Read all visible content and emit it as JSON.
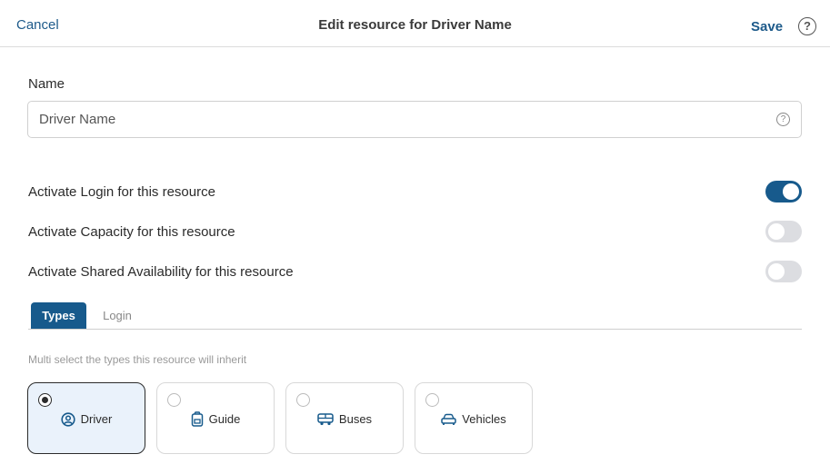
{
  "header": {
    "cancel_label": "Cancel",
    "title": "Edit resource for Driver Name",
    "save_label": "Save",
    "help_glyph": "?"
  },
  "name_field": {
    "label": "Name",
    "value": "Driver Name",
    "help_glyph": "?"
  },
  "toggles": [
    {
      "label": "Activate Login for this resource",
      "on": true
    },
    {
      "label": "Activate Capacity for this resource",
      "on": false
    },
    {
      "label": "Activate Shared Availability for this resource",
      "on": false
    }
  ],
  "tabs": [
    {
      "label": "Types",
      "active": true
    },
    {
      "label": "Login",
      "active": false
    }
  ],
  "hint": "Multi select the types this resource will inherit",
  "types": [
    {
      "label": "Driver",
      "icon": "user-circle-icon",
      "selected": true
    },
    {
      "label": "Guide",
      "icon": "backpack-icon",
      "selected": false
    },
    {
      "label": "Buses",
      "icon": "bus-icon",
      "selected": false
    },
    {
      "label": "Vehicles",
      "icon": "car-icon",
      "selected": false
    }
  ],
  "colors": {
    "accent": "#175a8c",
    "link": "#1d5a8a",
    "toggle_off": "#dcdde1",
    "selected_card_bg": "#eaf2fb"
  }
}
